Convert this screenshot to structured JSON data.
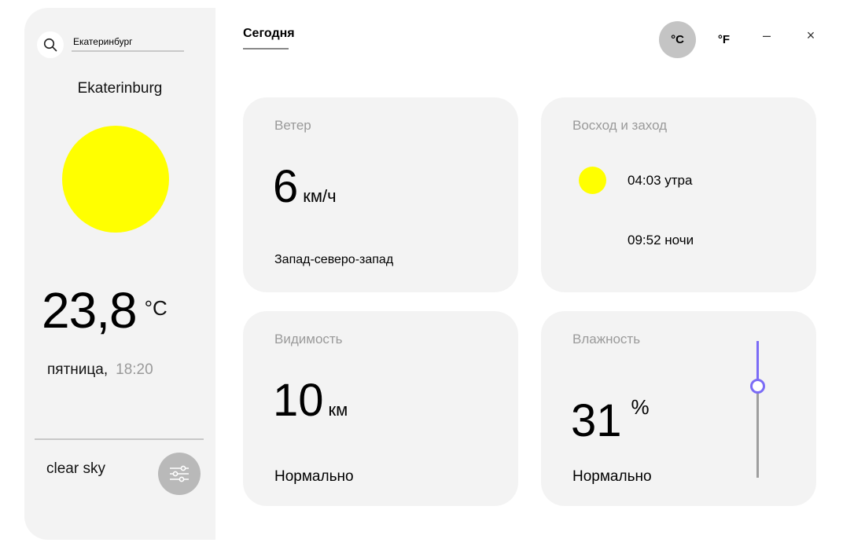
{
  "colors": {
    "sun": "#ffff00",
    "moon": "#9e9e9e",
    "accent": "#7b6cf6",
    "panel": "#f3f3f3"
  },
  "sidebar": {
    "search": {
      "value": "Екатеринбург",
      "icon": "search-icon"
    },
    "city": "Ekaterinburg",
    "weather_icon": "sun-icon",
    "temperature": "23,8",
    "temp_unit": "°C",
    "day": "пятница,",
    "time": "18:20",
    "condition": "clear sky",
    "settings_icon": "sliders-icon"
  },
  "header": {
    "tab_today": "Сегодня",
    "unit_c": "°C",
    "unit_f": "°F",
    "unit_selected": "°C",
    "minimize": "–",
    "close": "×"
  },
  "cards": {
    "wind": {
      "title": "Ветер",
      "value": "6",
      "unit": "км/ч",
      "direction": "Запад-северо-запад"
    },
    "sunrise_sunset": {
      "title": "Восход и заход",
      "sunrise": "04:03 утра",
      "sunset": "09:52 ночи"
    },
    "visibility": {
      "title": "Видимость",
      "value": "10",
      "unit": "км",
      "status": "Нормально"
    },
    "humidity": {
      "title": "Влажность",
      "value": "31",
      "unit": "%",
      "status": "Нормально",
      "level": 31
    }
  }
}
